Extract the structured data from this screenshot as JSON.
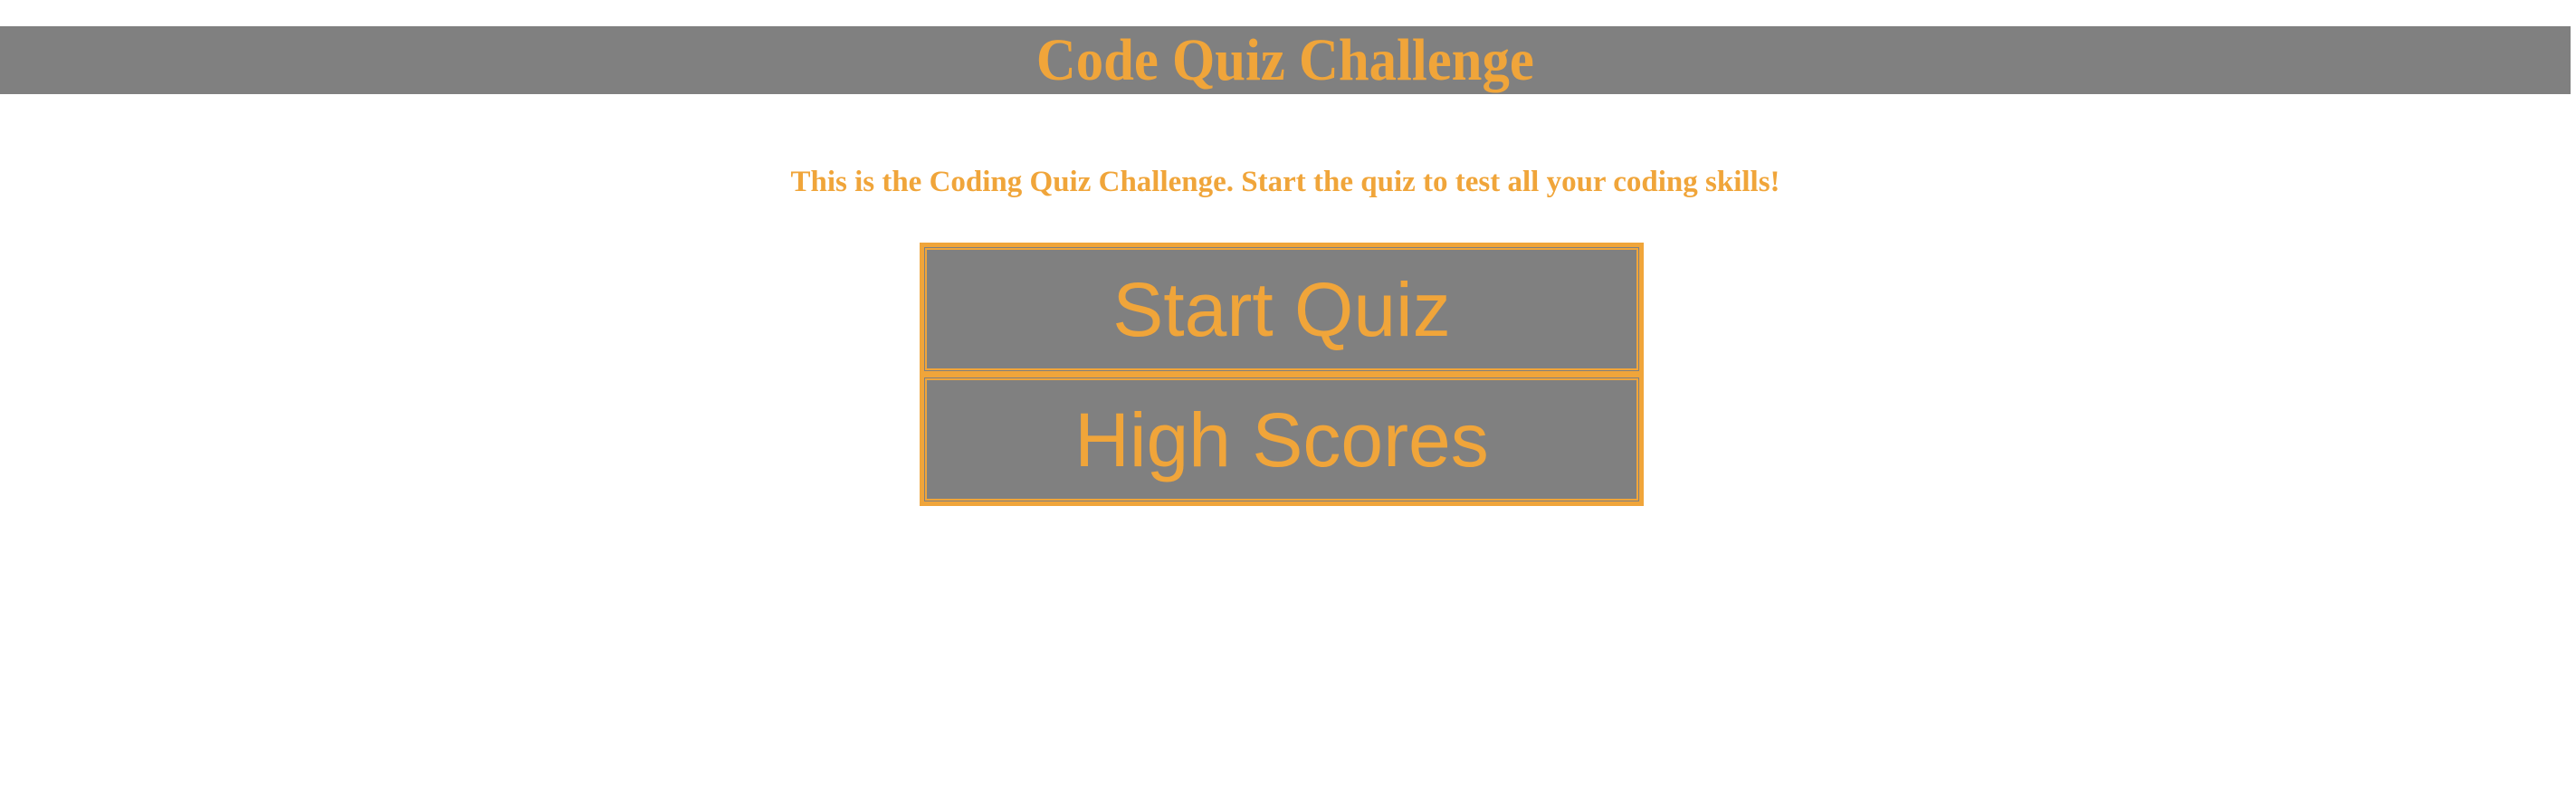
{
  "header": {
    "title": "Code Quiz Challenge"
  },
  "intro": {
    "text": "This is the Coding Quiz Challenge. Start the quiz to test all your coding skills!"
  },
  "buttons": {
    "start_label": "Start Quiz",
    "high_scores_label": "High Scores"
  },
  "colors": {
    "accent": "#f0a53a",
    "panel": "#808080"
  }
}
